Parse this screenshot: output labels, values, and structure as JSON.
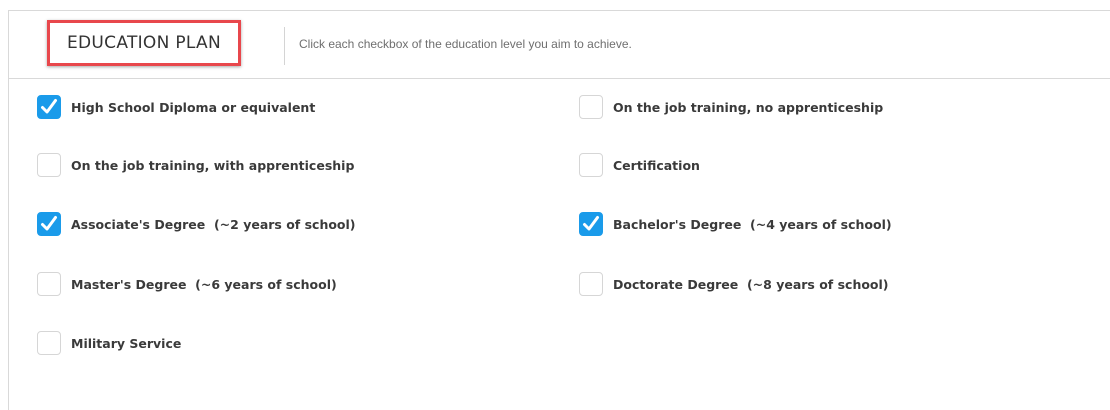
{
  "header": {
    "title": "EDUCATION PLAN",
    "instruction": "Click each checkbox of the education level you aim to achieve."
  },
  "colors": {
    "checked": "#1a9bea",
    "highlight_border": "#e8474c"
  },
  "options": [
    {
      "label": "High School Diploma or equivalent",
      "checked": true
    },
    {
      "label": "On the job training, no apprenticeship",
      "checked": false
    },
    {
      "label": "On the job training, with apprenticeship",
      "checked": false
    },
    {
      "label": "Certification",
      "checked": false
    },
    {
      "label": "Associate's Degree  (~2 years of school)",
      "checked": true
    },
    {
      "label": "Bachelor's Degree  (~4 years of school)",
      "checked": true
    },
    {
      "label": "Master's Degree  (~6 years of school)",
      "checked": false
    },
    {
      "label": "Doctorate Degree  (~8 years of school)",
      "checked": false
    },
    {
      "label": "Military Service",
      "checked": false
    }
  ]
}
